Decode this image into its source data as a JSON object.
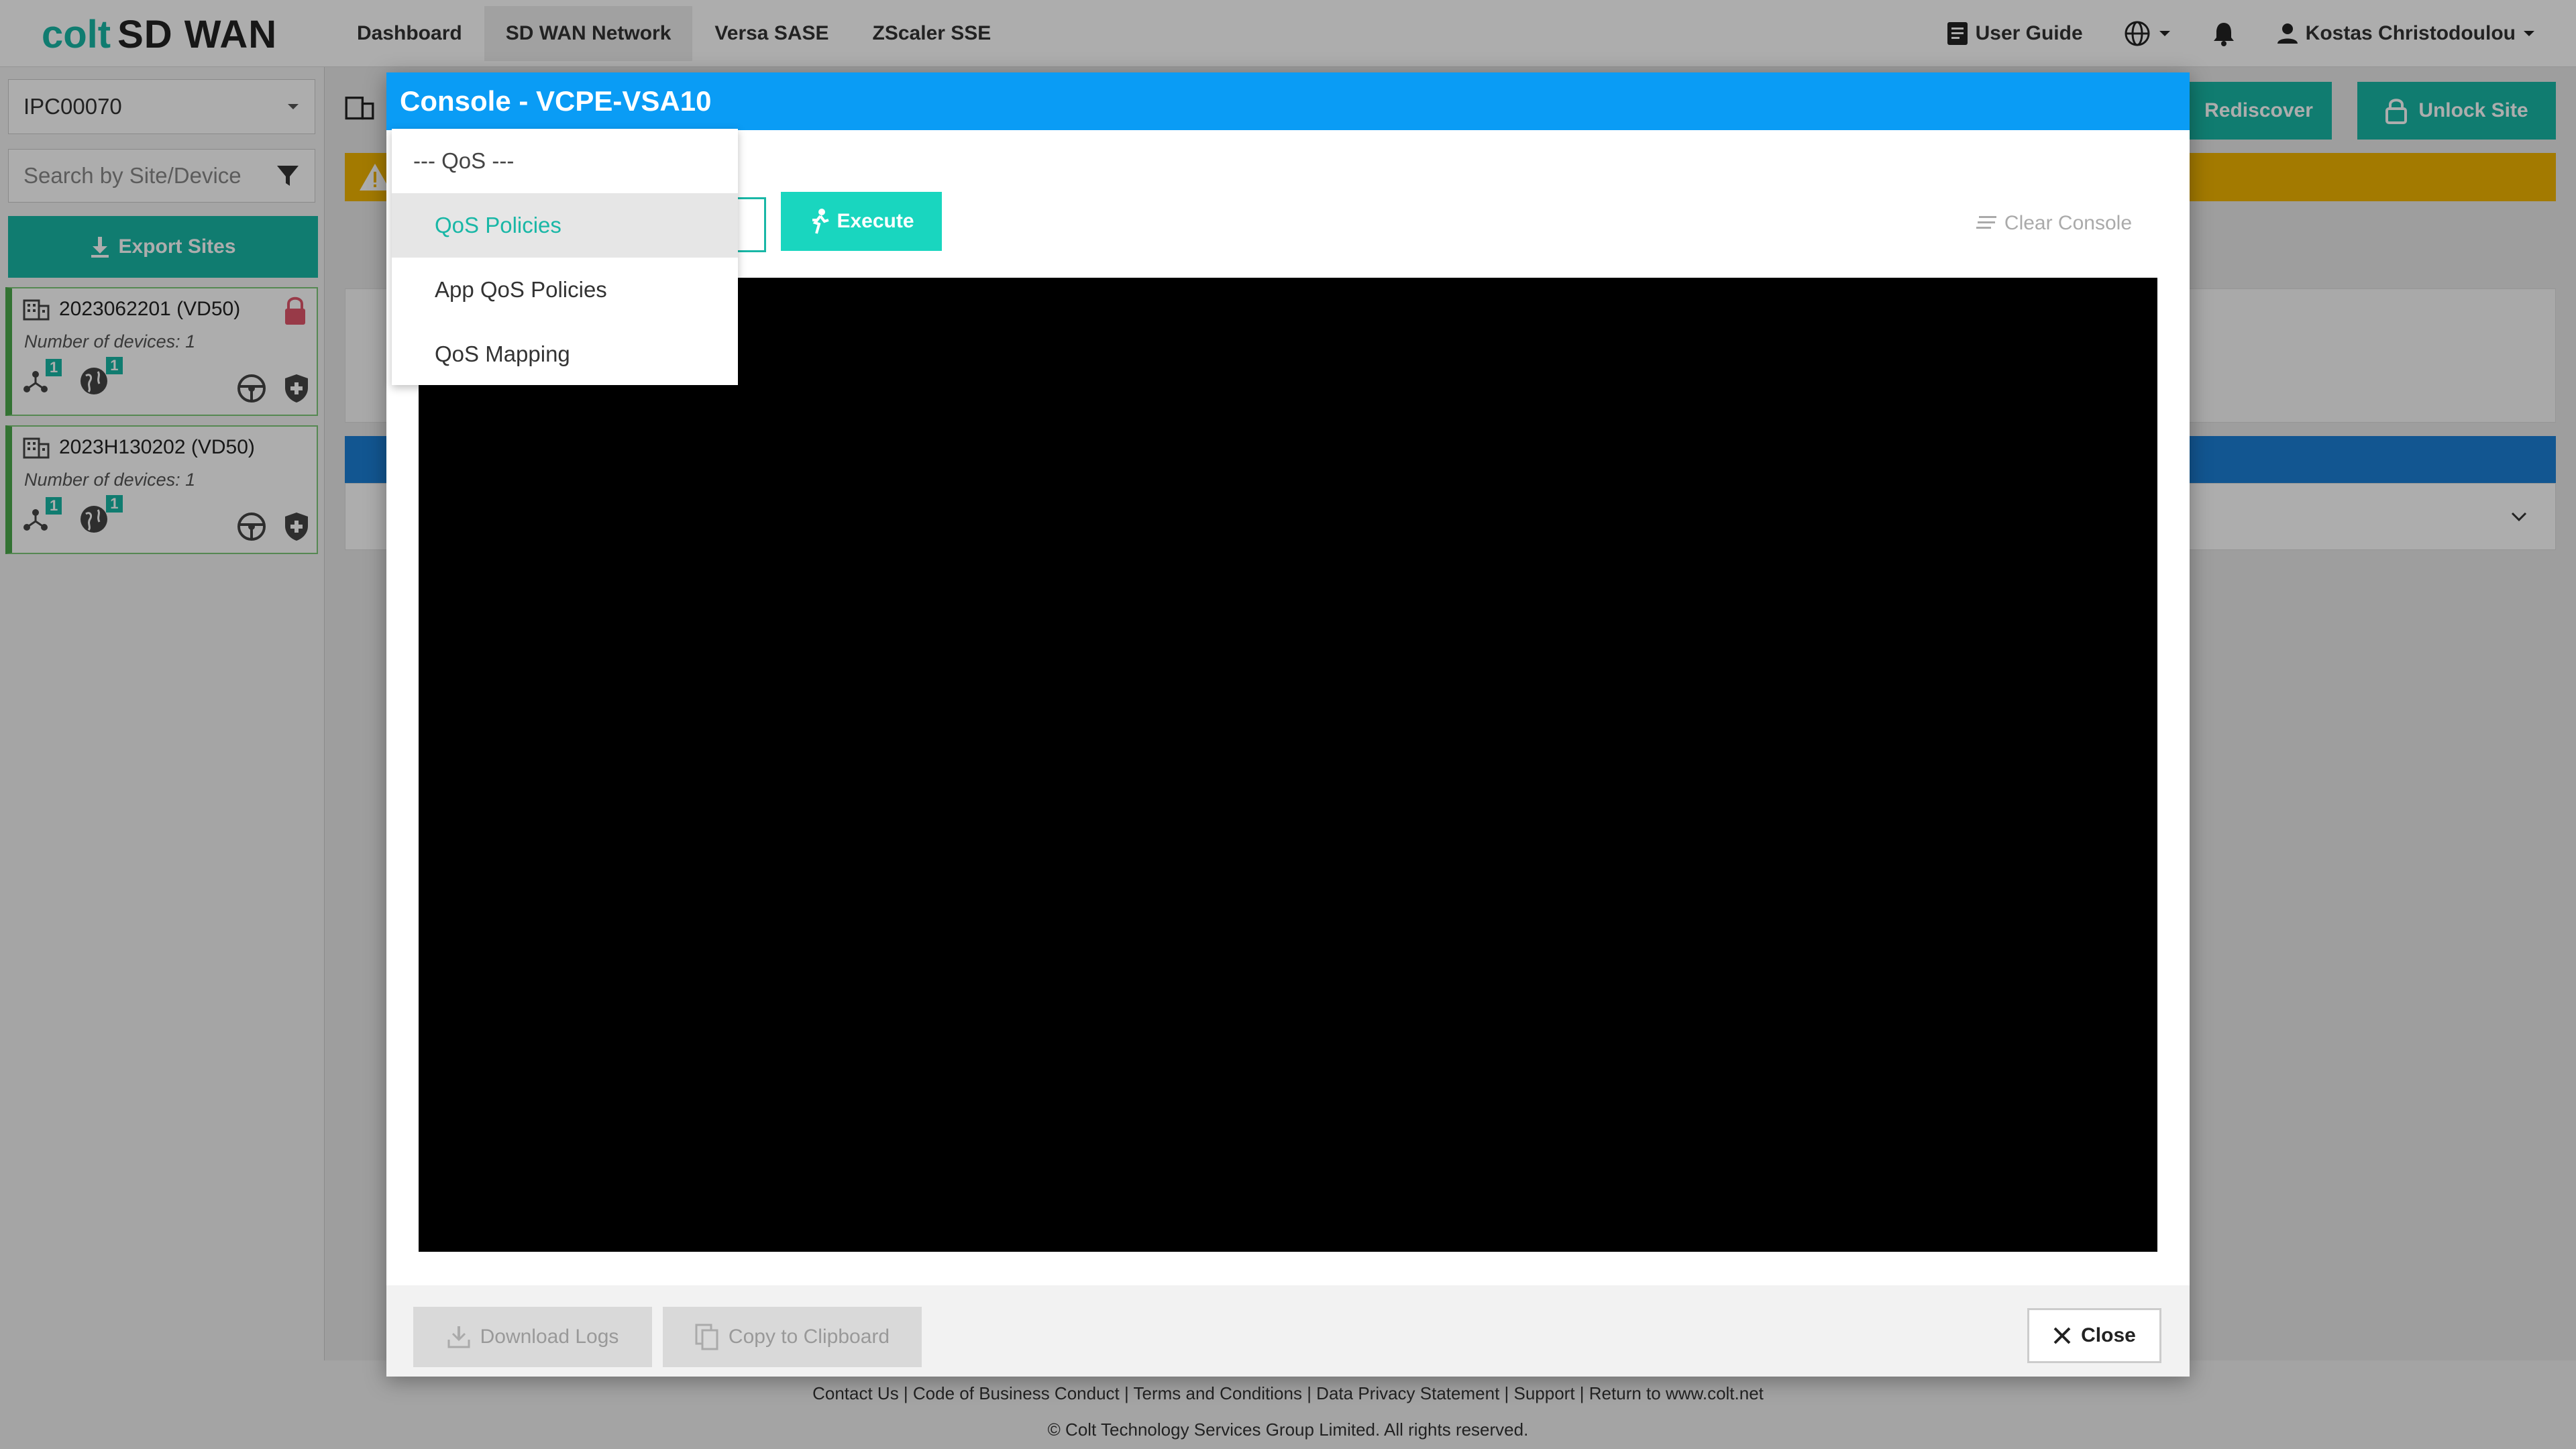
{
  "header": {
    "logo_brand": "colt",
    "logo_product": "SD WAN",
    "nav": [
      {
        "label": "Dashboard",
        "active": false
      },
      {
        "label": "SD WAN Network",
        "active": true
      },
      {
        "label": "Versa SASE",
        "active": false
      },
      {
        "label": "ZScaler SSE",
        "active": false
      }
    ],
    "user_guide": "User Guide",
    "user_name": "Kostas Christodoulou"
  },
  "sidebar": {
    "customer_select": "IPC00070",
    "search_placeholder": "Search by Site/Device",
    "export_label": "Export Sites",
    "sites": [
      {
        "name": "2023062201 (VD50)",
        "devices": "Number of devices: 1",
        "badge_a": "1",
        "badge_b": "1",
        "locked": true
      },
      {
        "name": "2023H130202 (VD50)",
        "devices": "Number of devices: 1",
        "badge_a": "1",
        "badge_b": "1",
        "locked": false
      }
    ]
  },
  "page": {
    "rediscover_label": "Rediscover",
    "unlock_label": "Unlock Site"
  },
  "modal": {
    "title": "Console - VCPE-VSA10",
    "execute_label": "Execute",
    "clear_label": "Clear Console",
    "download_label": "Download Logs",
    "copy_label": "Copy to Clipboard",
    "close_label": "Close"
  },
  "dropdown": {
    "items": [
      {
        "label": "--- QoS ---",
        "type": "header"
      },
      {
        "label": "QoS Policies",
        "type": "selected"
      },
      {
        "label": "App QoS Policies",
        "type": "option"
      },
      {
        "label": "QoS Mapping",
        "type": "option"
      }
    ]
  },
  "footer": {
    "links": [
      "Contact Us",
      "Code of Business Conduct",
      "Terms and Conditions",
      "Data Privacy Statement",
      "Support",
      "Return to www.colt.net"
    ],
    "copyright": "© Colt Technology Services Group Limited. All rights reserved."
  },
  "colors": {
    "brand_teal": "#19b7a6",
    "modal_header": "#0a9cf5",
    "warning": "#f0b400"
  }
}
